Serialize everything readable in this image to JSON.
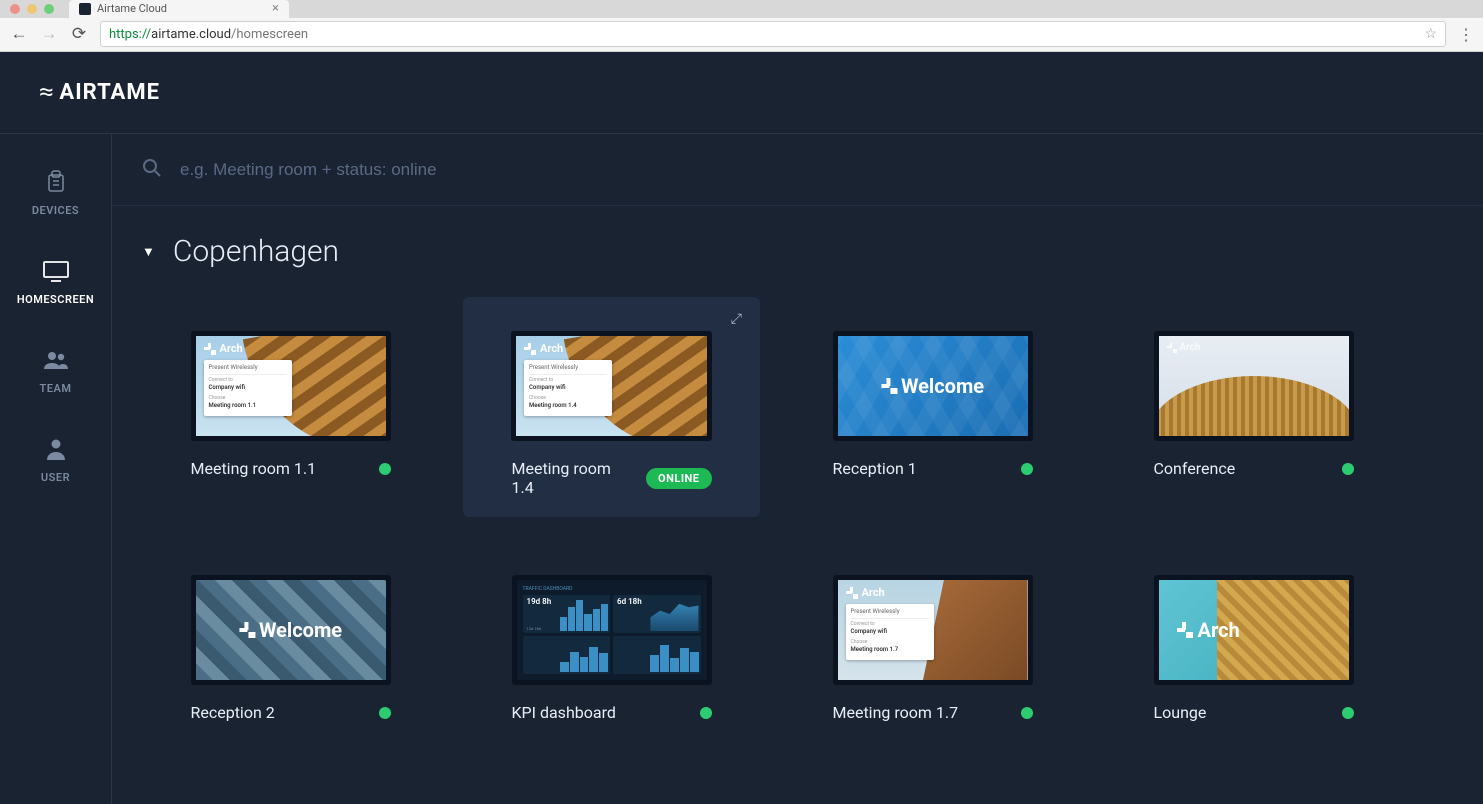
{
  "browser": {
    "tab_title": "Airtame Cloud",
    "url_prefix": "https://",
    "url_host": "airtame.cloud",
    "url_path": "/homescreen"
  },
  "brand": {
    "name": "AIRTAME"
  },
  "sidebar": {
    "items": [
      {
        "label": "DEVICES"
      },
      {
        "label": "HOMESCREEN"
      },
      {
        "label": "TEAM"
      },
      {
        "label": "USER"
      }
    ]
  },
  "search": {
    "placeholder": "e.g. Meeting room + status: online"
  },
  "group": {
    "name": "Copenhagen"
  },
  "devices": [
    {
      "name": "Meeting room 1.1",
      "status": "online",
      "badge": false,
      "thumb": "arch-info",
      "info_room": "Meeting room 1.1",
      "info_wifi": "Company wifi",
      "info_hdr": "Present Wirelessly"
    },
    {
      "name": "Meeting room 1.4",
      "status": "online",
      "badge": true,
      "badge_text": "ONLINE",
      "thumb": "arch-info",
      "info_room": "Meeting room 1.4",
      "info_wifi": "Company wifi",
      "info_hdr": "Present Wirelessly"
    },
    {
      "name": "Reception 1",
      "status": "online",
      "badge": false,
      "thumb": "welcome",
      "overlay_text": "Welcome"
    },
    {
      "name": "Conference",
      "status": "online",
      "badge": false,
      "thumb": "conference",
      "overlay_text": "Arch"
    },
    {
      "name": "Reception 2",
      "status": "online",
      "badge": false,
      "thumb": "welcome2",
      "overlay_text": "Welcome"
    },
    {
      "name": "KPI dashboard",
      "status": "online",
      "badge": false,
      "thumb": "kpi",
      "kpi": {
        "a": "19d 8h",
        "b": "6d 18h"
      }
    },
    {
      "name": "Meeting room 1.7",
      "status": "online",
      "badge": false,
      "thumb": "arch-info2",
      "info_room": "Meeting room 1.7",
      "info_wifi": "Company wifi",
      "info_hdr": "Present Wirelessly"
    },
    {
      "name": "Lounge",
      "status": "online",
      "badge": false,
      "thumb": "lounge",
      "overlay_text": "Arch"
    }
  ]
}
